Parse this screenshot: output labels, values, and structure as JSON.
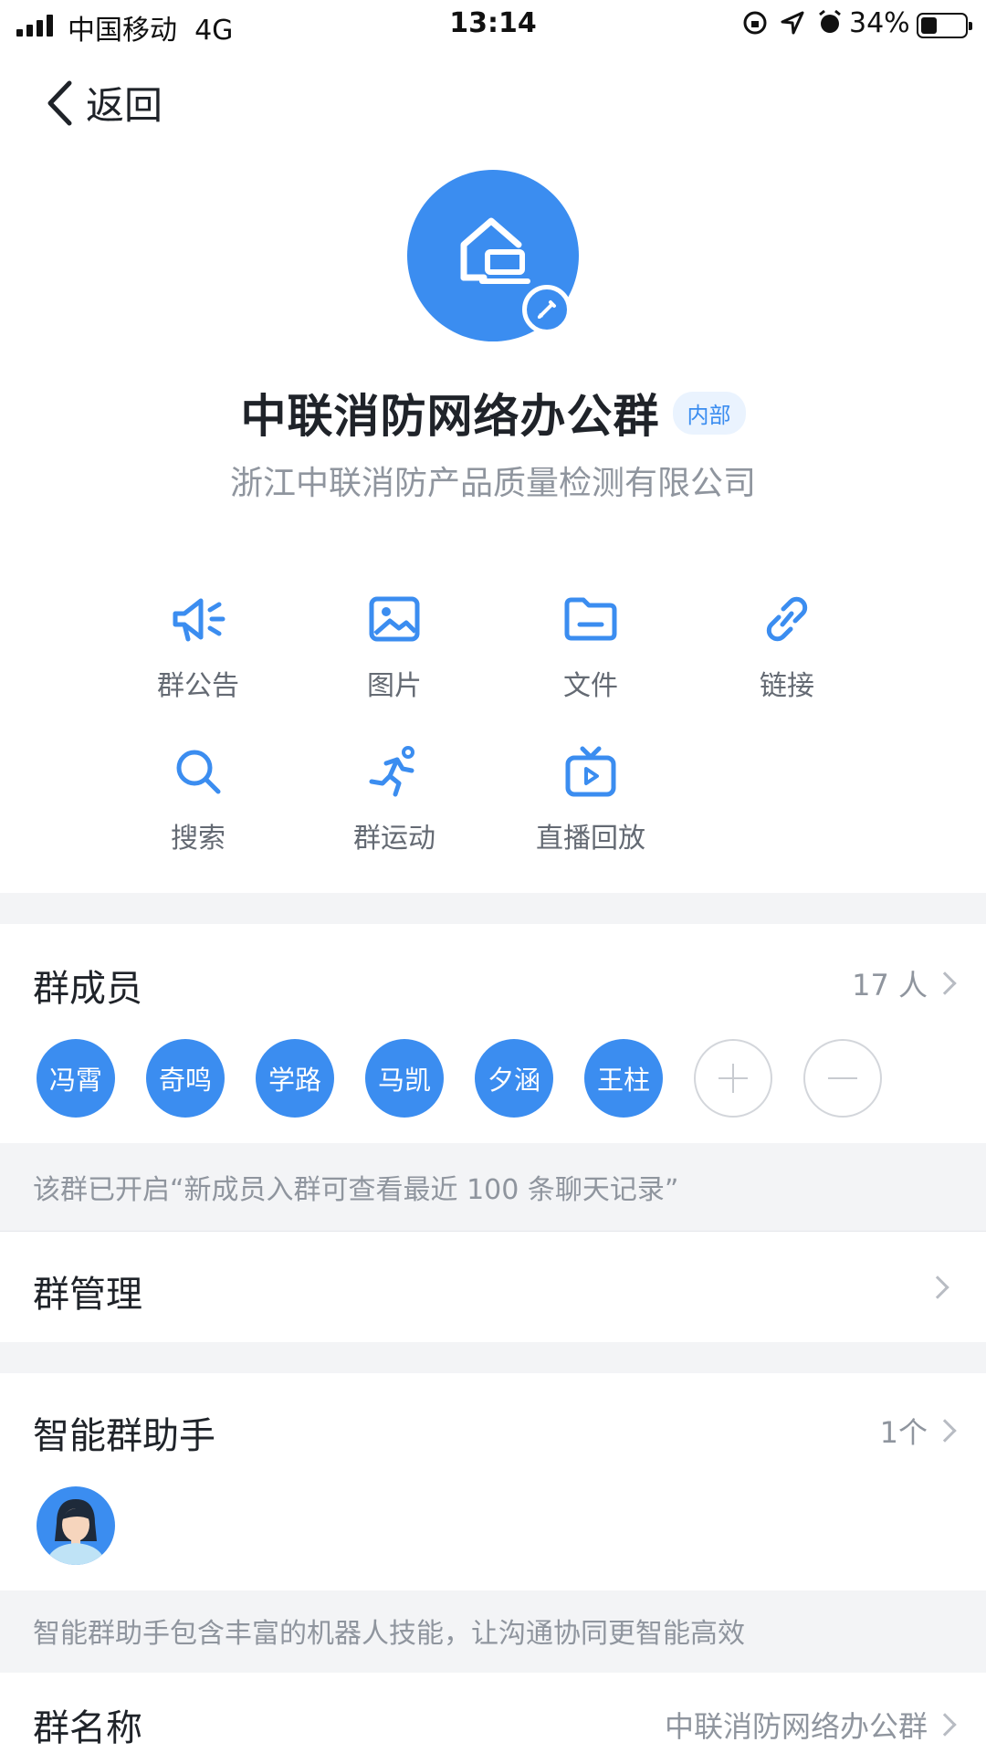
{
  "status_bar": {
    "carrier": "中国移动",
    "network": "4G",
    "time": "13:14",
    "battery": "34%"
  },
  "nav": {
    "back_label": "返回"
  },
  "group": {
    "name": "中联消防网络办公群",
    "tag": "内部",
    "org": "浙江中联消防产品质量检测有限公司"
  },
  "features": [
    {
      "label": "群公告",
      "icon": "megaphone-icon"
    },
    {
      "label": "图片",
      "icon": "image-icon"
    },
    {
      "label": "文件",
      "icon": "folder-icon"
    },
    {
      "label": "链接",
      "icon": "link-icon"
    },
    {
      "label": "搜索",
      "icon": "search-icon"
    },
    {
      "label": "群运动",
      "icon": "run-icon"
    },
    {
      "label": "直播回放",
      "icon": "tv-play-icon"
    }
  ],
  "members": {
    "title": "群成员",
    "count": "17 人",
    "list": [
      "冯霄",
      "奇鸣",
      "学路",
      "马凯",
      "夕涵",
      "王柱"
    ],
    "note": "该群已开启“新成员入群可查看最近 100 条聊天记录”"
  },
  "manage": {
    "title": "群管理"
  },
  "assistant": {
    "title": "智能群助手",
    "count": "1个",
    "note": "智能群助手包含丰富的机器人技能，让沟通协同更智能高效"
  },
  "group_name_row": {
    "title": "群名称",
    "value": "中联消防网络办公群"
  },
  "colors": {
    "accent": "#3b8df0",
    "section_gap": "#f3f4f6",
    "muted_text": "#8f959e"
  }
}
